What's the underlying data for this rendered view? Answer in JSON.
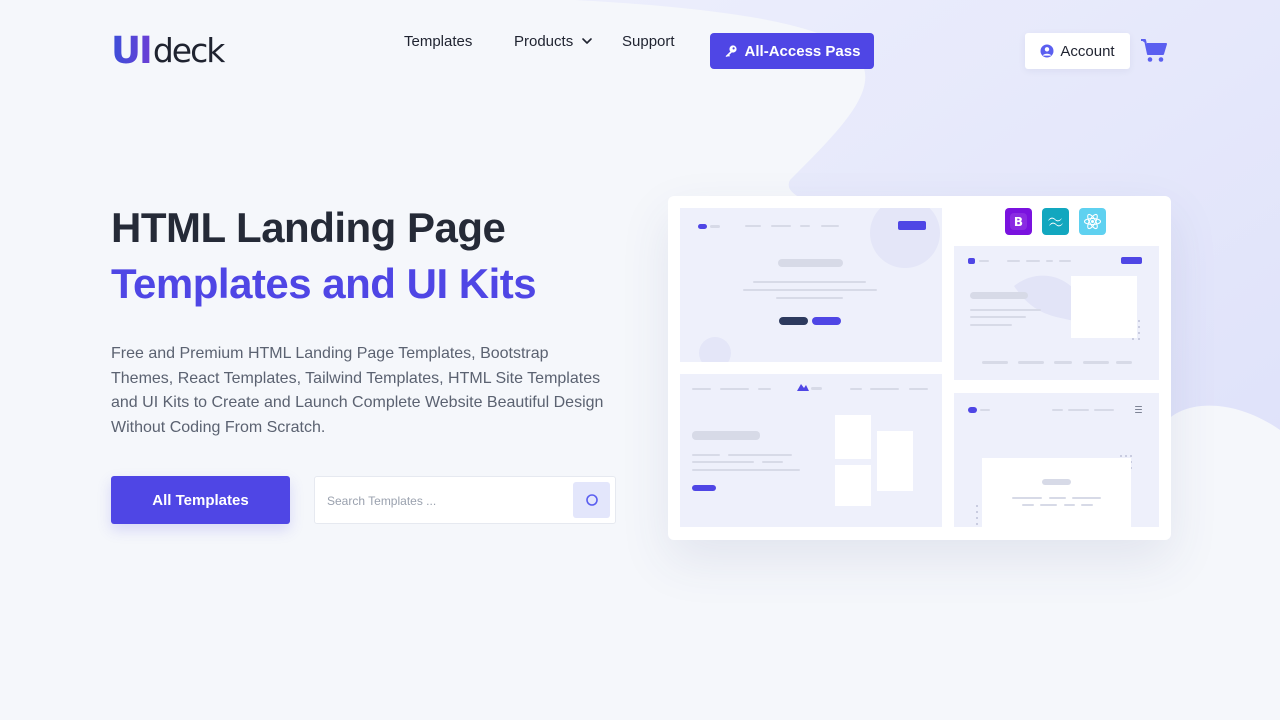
{
  "brand": {
    "logo_ui": "UI",
    "logo_deck": "deck"
  },
  "nav": {
    "templates": "Templates",
    "products": "Products",
    "support": "Support",
    "all_access": "All-Access Pass",
    "account": "Account"
  },
  "hero": {
    "title_line1": "HTML Landing Page",
    "title_line2": "Templates and UI Kits",
    "description": "Free and Premium HTML Landing Page Templates, Bootstrap Themes, React Templates, Tailwind Templates, HTML Site Templates and UI Kits to Create and Launch Complete Website Beautiful Design Without Coding From Scratch.",
    "cta_label": "All Templates",
    "search_placeholder": "Search Templates ..."
  },
  "colors": {
    "accent": "#4f46e5",
    "heading": "#252a37",
    "background": "#f5f7fb",
    "blob": "#e6e8fb"
  },
  "icons": {
    "key": "key-icon",
    "user": "user-icon",
    "cart": "cart-icon",
    "search": "search-icon",
    "chevron": "chevron-down-icon",
    "bootstrap": "bootstrap-icon",
    "tailwind": "tailwind-icon",
    "react": "react-icon"
  },
  "showcase": {
    "bootstrap_letter": "B"
  }
}
